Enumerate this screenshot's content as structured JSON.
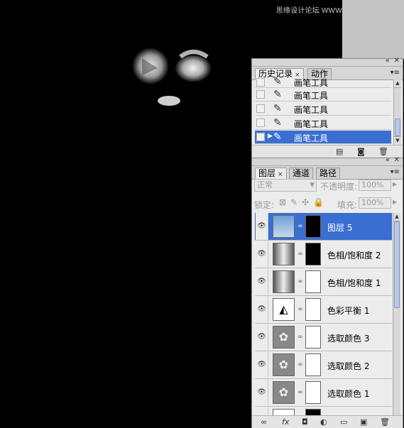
{
  "watermark": "思缘设计论坛 WWW.MISSYUAN.COM",
  "history_panel": {
    "tabs": [
      {
        "label": "历史记录",
        "close": "×"
      },
      {
        "label": "动作"
      }
    ],
    "menu_icon": "panel-menu-icon",
    "items": [
      {
        "label": "画笔工具"
      },
      {
        "label": "画笔工具"
      },
      {
        "label": "画笔工具"
      },
      {
        "label": "画笔工具"
      },
      {
        "label": "画笔工具",
        "selected": true
      }
    ],
    "footer_icons": [
      "new-document-from-state-icon",
      "camera-snapshot-icon",
      "trash-icon"
    ]
  },
  "layers_panel": {
    "tabs": [
      {
        "label": "图层",
        "close": "×"
      },
      {
        "label": "通道"
      },
      {
        "label": "路径"
      }
    ],
    "blend_mode": "正常",
    "opacity_label": "不透明度:",
    "opacity_value": "100%",
    "lock_label": "锁定:",
    "fill_label": "填充:",
    "fill_value": "100%",
    "layers": [
      {
        "name": "图层 5",
        "selected": true
      },
      {
        "name": "色相/饱和度 2"
      },
      {
        "name": "色相/饱和度 1"
      },
      {
        "name": "色彩平衡 1"
      },
      {
        "name": "选取颜色 3"
      },
      {
        "name": "选取颜色 2"
      },
      {
        "name": "选取颜色 1"
      }
    ],
    "footer_icons": [
      "link-layers-icon",
      "fx-icon",
      "add-mask-icon",
      "adjustment-layer-icon",
      "group-folder-icon",
      "new-layer-icon",
      "trash-icon"
    ]
  }
}
